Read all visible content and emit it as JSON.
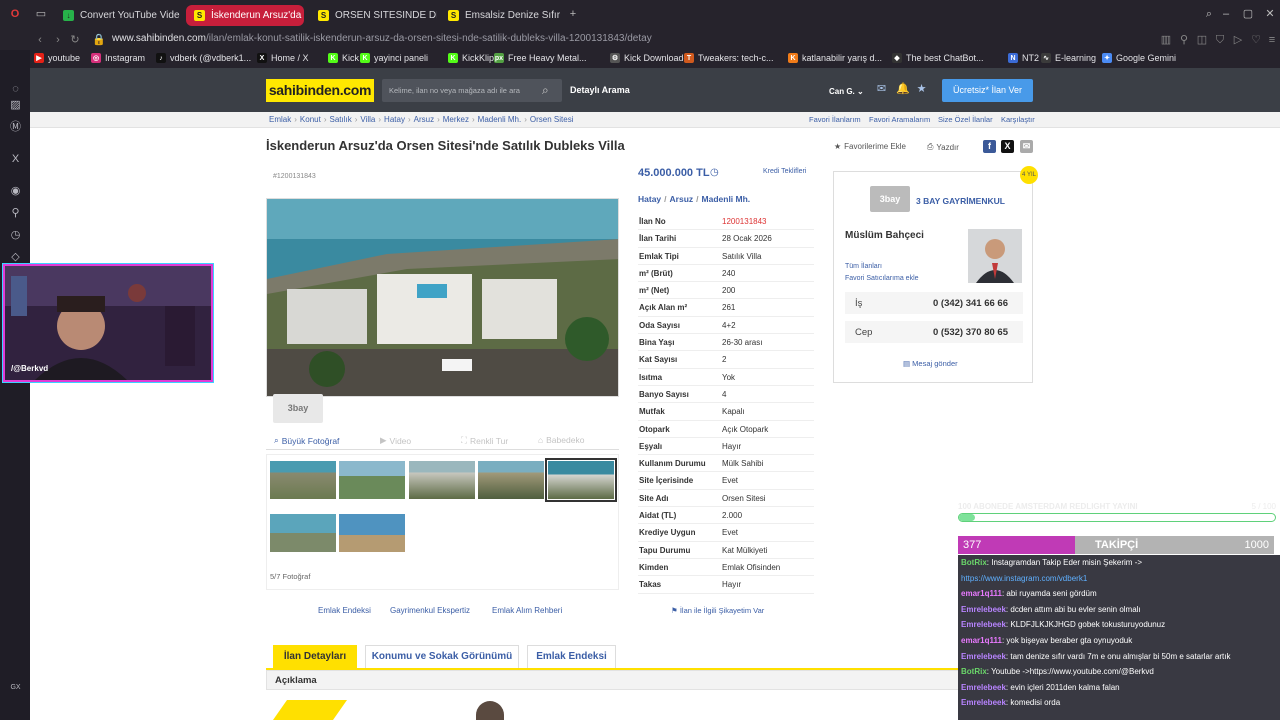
{
  "browser": {
    "tabs": [
      {
        "label": "Convert YouTube Videos t",
        "color": "#27b24a",
        "glyph": "↓"
      },
      {
        "label": "İskenderun Arsuz'da Orse",
        "color": "#ffe800",
        "glyph": "S",
        "active": true
      },
      {
        "label": "ORSEN SITESINDE DENIZ",
        "color": "#ffe800",
        "glyph": "S"
      },
      {
        "label": "Emsalsiz Denize Sıfır Nezi",
        "color": "#ffe800",
        "glyph": "S"
      }
    ],
    "url_host": "www.sahibinden.com",
    "url_path": "/ilan/emlak-konut-satilik-iskenderun-arsuz-da-orsen-sitesi-nde-satilik-dubleks-villa-1200131843/detay",
    "bookmarks": [
      {
        "label": "youtube",
        "color": "#e62117",
        "glyph": "▶"
      },
      {
        "label": "Instagram",
        "color": "#d6307b",
        "glyph": "◎"
      },
      {
        "label": "vdberk (@vdberk1...",
        "color": "#111111",
        "glyph": "♪"
      },
      {
        "label": "Home / X",
        "color": "#111111",
        "glyph": "X"
      },
      {
        "label": "Kick",
        "color": "#53fc18",
        "glyph": "K"
      },
      {
        "label": "yayinci paneli",
        "color": "#53fc18",
        "glyph": "K"
      },
      {
        "label": "KickKlip",
        "color": "#53fc18",
        "glyph": "K"
      },
      {
        "label": "Free Heavy Metal...",
        "color": "#53a043",
        "glyph": "px"
      },
      {
        "label": "Kick Downloader",
        "color": "#555555",
        "glyph": "⚙"
      },
      {
        "label": "Tweakers: tech-c...",
        "color": "#d15a1e",
        "glyph": "T"
      },
      {
        "label": "katlanabilir yarış d...",
        "color": "#f07b19",
        "glyph": "K"
      },
      {
        "label": "The best ChatBot...",
        "color": "#333333",
        "glyph": "◆"
      },
      {
        "label": "NT2",
        "color": "#3b6bd6",
        "glyph": "N"
      },
      {
        "label": "E-learning",
        "color": "#3b3b3b",
        "glyph": "∿"
      },
      {
        "label": "Google Gemini",
        "color": "#4b8bf4",
        "glyph": "✦"
      }
    ]
  },
  "site": {
    "logo": "sahibinden.com",
    "search_placeholder": "Kelime, ilan no veya mağaza adı ile ara",
    "detailed_search": "Detaylı Arama",
    "user": "Can G.",
    "cta": "Ücretsiz* İlan Ver",
    "breadcrumb": [
      "Emlak",
      "Konut",
      "Satılık",
      "Villa",
      "Hatay",
      "Arsuz",
      "Merkez",
      "Madenli Mh.",
      "Orsen Sitesi"
    ],
    "right_links": [
      "Favori İlanlarım",
      "Favori Aramalarım",
      "Size Özel İlanlar",
      "Karşılaştır"
    ]
  },
  "listing": {
    "title": "İskenderun Arsuz'da Orsen Sitesi'nde Satılık Dubleks Villa",
    "fav": "Favorilerime Ekle",
    "print": "Yazdır",
    "id_tag": "#1200131843",
    "price": "45.000.000 TL",
    "credit": "Kredi Teklifleri",
    "location": [
      "Hatay",
      "Arsuz",
      "Madenli Mh."
    ],
    "photo_watermark": "3bay",
    "photo_tabs": [
      {
        "label": "Büyük Fotoğraf",
        "active": true
      },
      {
        "label": "Video"
      },
      {
        "label": "Renkli Tur"
      },
      {
        "label": "Babedeko"
      }
    ],
    "photo_count": "5/7 Fotoğraf",
    "attributes": [
      {
        "k": "İlan No",
        "v": "1200131843",
        "red": true
      },
      {
        "k": "İlan Tarihi",
        "v": "28 Ocak 2026"
      },
      {
        "k": "Emlak Tipi",
        "v": "Satılık Villa"
      },
      {
        "k": "m² (Brüt)",
        "v": "240"
      },
      {
        "k": "m² (Net)",
        "v": "200"
      },
      {
        "k": "Açık Alan m²",
        "v": "261"
      },
      {
        "k": "Oda Sayısı",
        "v": "4+2"
      },
      {
        "k": "Bina Yaşı",
        "v": "26-30 arası"
      },
      {
        "k": "Kat Sayısı",
        "v": "2"
      },
      {
        "k": "Isıtma",
        "v": "Yok"
      },
      {
        "k": "Banyo Sayısı",
        "v": "4"
      },
      {
        "k": "Mutfak",
        "v": "Kapalı"
      },
      {
        "k": "Otopark",
        "v": "Açık Otopark"
      },
      {
        "k": "Eşyalı",
        "v": "Hayır"
      },
      {
        "k": "Kullanım Durumu",
        "v": "Mülk Sahibi"
      },
      {
        "k": "Site İçerisinde",
        "v": "Evet"
      },
      {
        "k": "Site Adı",
        "v": "Orsen Sitesi"
      },
      {
        "k": "Aidat (TL)",
        "v": "2.000"
      },
      {
        "k": "Krediye Uygun",
        "v": "Evet"
      },
      {
        "k": "Tapu Durumu",
        "v": "Kat Mülkiyeti"
      },
      {
        "k": "Kimden",
        "v": "Emlak Ofisinden"
      },
      {
        "k": "Takas",
        "v": "Hayır"
      }
    ],
    "bottom_links": [
      "Emlak Endeksi",
      "Gayrimenkul Ekspertiz",
      "Emlak Alım Rehberi"
    ],
    "complaint": "İlan ile İlgili Şikayetim Var",
    "content_tabs": [
      "İlan Detayları",
      "Konumu ve Sokak Görünümü",
      "Emlak Endeksi"
    ],
    "desc_header": "Açıklama"
  },
  "seller": {
    "agency_logo": "3bay",
    "agency": "3 BAY GAYRİMENKUL",
    "name": "Müslüm Bahçeci",
    "all": "Tüm İlanları",
    "fav": "Favori Satıcılarıma ekle",
    "phones": [
      {
        "label": "İş",
        "num": "0 (342) 341 66 66"
      },
      {
        "label": "Cep",
        "num": "0 (532) 370 80 65"
      }
    ],
    "message": "Mesaj gönder",
    "badge": "4 YIL"
  },
  "stream": {
    "cam_name": "/@Berkvd",
    "goal_title": "100 ABONEDE AMSTERDAM REDLIGHT YAYINI",
    "goal_count": "5 / 100",
    "goal_progress": 0.05,
    "follower_now": "377",
    "follower_label": "TAKİPÇİ",
    "follower_target": "1000",
    "chat": [
      {
        "u": "BotRix",
        "c": "#6ad66a",
        "t": ": Instagramdan Takip Eder misin Şekerim ->"
      },
      {
        "u": "",
        "c": "#5fb0ff",
        "t": "https://www.instagram.com/vdberk1"
      },
      {
        "u": "emar1q111",
        "c": "#e97aff",
        "t": ": abi ruyamda seni gördüm"
      },
      {
        "u": "Emrelebeek",
        "c": "#b884ff",
        "t": ": dcden attım abi bu evler senin olmalı"
      },
      {
        "u": "Emrelebeek",
        "c": "#b884ff",
        "t": ": KLDFJLKJKJHGD gobek tokusturuyodunuz"
      },
      {
        "u": "emar1q111",
        "c": "#e97aff",
        "t": ": yok bişeyav beraber gta oynuyoduk"
      },
      {
        "u": "Emrelebeek",
        "c": "#b884ff",
        "t": ": tam denize sıfır vardı 7m e onu almışlar bi 50m e satarlar artık"
      },
      {
        "u": "BotRix",
        "c": "#6ad66a",
        "t": ": Youtube ->https://www.youtube.com/@Berkvd"
      },
      {
        "u": "Emrelebeek",
        "c": "#b884ff",
        "t": ": evin içleri 2011den kalma falan"
      },
      {
        "u": "Emrelebeek",
        "c": "#b884ff",
        "t": ": komedisi orda"
      }
    ]
  }
}
